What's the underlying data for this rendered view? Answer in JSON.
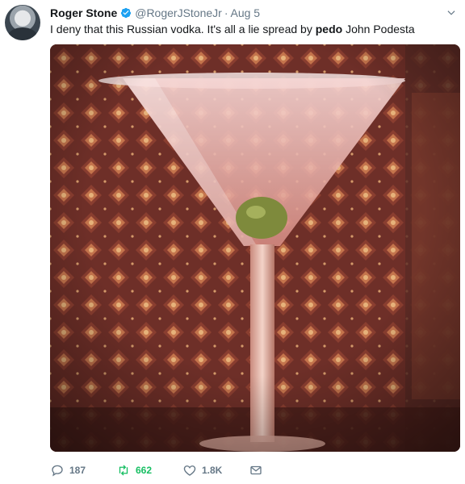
{
  "author": {
    "name": "Roger Stone",
    "handle": "@RogerJStoneJr",
    "separator": "·",
    "date": "Aug 5"
  },
  "tweet": {
    "text_before": "I deny that this Russian vodka. It's all a lie spread by ",
    "text_bold": "pedo",
    "text_after": " John Podesta"
  },
  "actions": {
    "reply_count": "187",
    "retweet_count": "662",
    "like_count": "1.8K"
  },
  "colors": {
    "retweet_green": "#17bf63",
    "muted_gray": "#657786",
    "verified_blue": "#1da1f2"
  }
}
